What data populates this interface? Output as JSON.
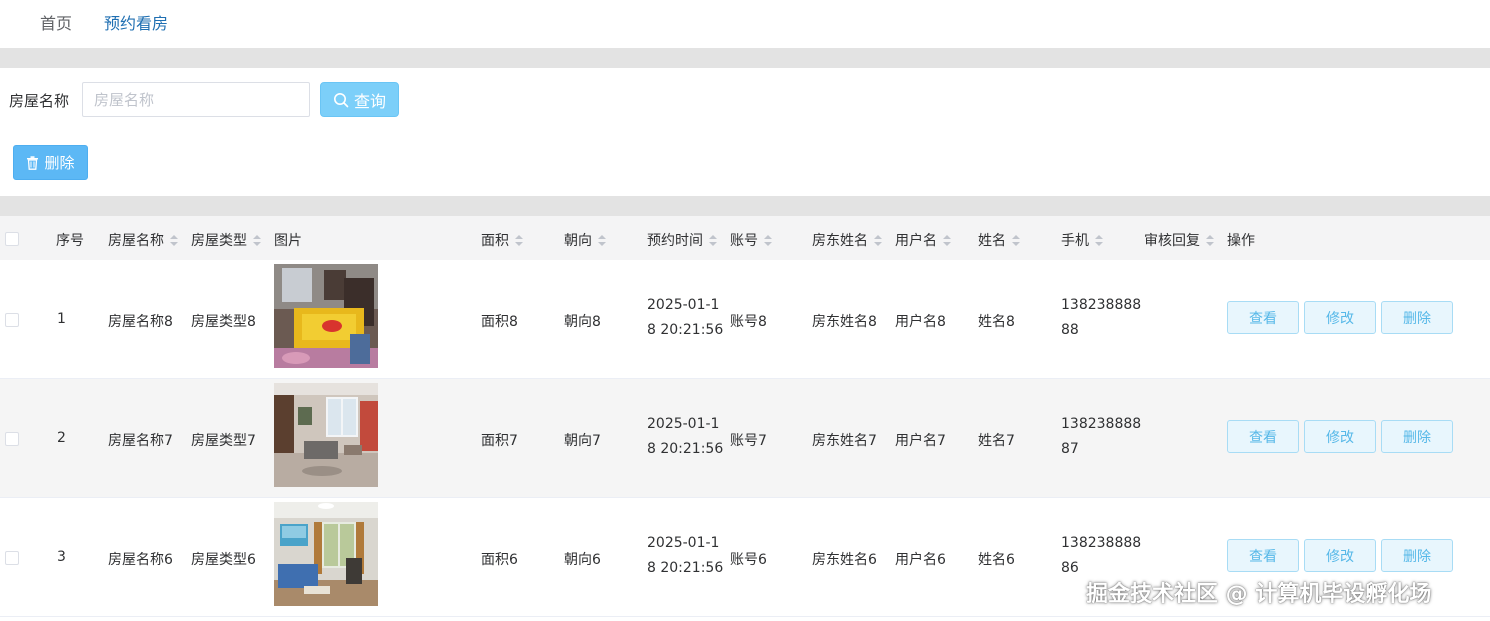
{
  "nav": {
    "items": [
      {
        "label": "首页"
      },
      {
        "label": "预约看房"
      }
    ]
  },
  "search": {
    "label": "房屋名称",
    "placeholder": "房屋名称",
    "value": "",
    "button_label": "查询"
  },
  "toolbar": {
    "delete_label": "删除"
  },
  "table": {
    "headers": {
      "index": "序号",
      "name": "房屋名称",
      "type": "房屋类型",
      "image": "图片",
      "area": "面积",
      "orientation": "朝向",
      "time": "预约时间",
      "account": "账号",
      "landlord": "房东姓名",
      "username": "用户名",
      "realname": "姓名",
      "phone": "手机",
      "review": "审核回复",
      "actions": "操作"
    },
    "rows": [
      {
        "index": "1",
        "name": "房屋名称8",
        "type": "房屋类型8",
        "area": "面积8",
        "orientation": "朝向8",
        "time_l1": "2025-01-1",
        "time_l2": "8 20:21:56",
        "account": "账号8",
        "landlord": "房东姓名8",
        "username": "用户名8",
        "realname": "姓名8",
        "phone_l1": "138238888",
        "phone_l2": "88",
        "review": "",
        "image": "bedroom-photo"
      },
      {
        "index": "2",
        "name": "房屋名称7",
        "type": "房屋类型7",
        "area": "面积7",
        "orientation": "朝向7",
        "time_l1": "2025-01-1",
        "time_l2": "8 20:21:56",
        "account": "账号7",
        "landlord": "房东姓名7",
        "username": "用户名7",
        "realname": "姓名7",
        "phone_l1": "138238888",
        "phone_l2": "87",
        "review": "",
        "image": "living-room-photo"
      },
      {
        "index": "3",
        "name": "房屋名称6",
        "type": "房屋类型6",
        "area": "面积6",
        "orientation": "朝向6",
        "time_l1": "2025-01-1",
        "time_l2": "8 20:21:56",
        "account": "账号6",
        "landlord": "房东姓名6",
        "username": "用户名6",
        "realname": "姓名6",
        "phone_l1": "138238888",
        "phone_l2": "86",
        "review": "",
        "image": "sitting-room-photo"
      }
    ],
    "actions": {
      "view": "查看",
      "edit": "修改",
      "delete": "删除"
    }
  },
  "watermark": "掘金技术社区 @ 计算机毕设孵化场",
  "colors": {
    "accent": "#409eff",
    "query_button": "#7ccff9",
    "delete_button": "#5cb8f5",
    "action_text": "#56b8e8",
    "nav_active": "#1f6fb2"
  },
  "icons": {
    "search": "search-icon",
    "delete": "trash-icon"
  }
}
